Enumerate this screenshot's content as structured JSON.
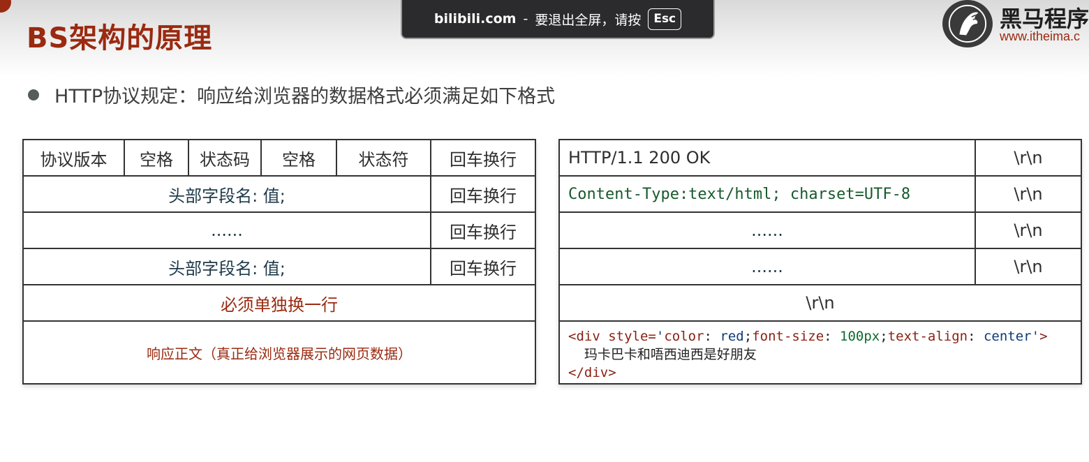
{
  "slide": {
    "title": "BS架构的原理",
    "bullet": "HTTP协议规定：响应给浏览器的数据格式必须满足如下格式"
  },
  "fullscreen_banner": {
    "site": "bilibili.com",
    "separator": "-",
    "message": "要退出全屏，请按",
    "key": "Esc"
  },
  "logo": {
    "icon": "horse-logo-icon",
    "name": "黑马程序",
    "url": "www.itheima.c"
  },
  "left_table": {
    "status_line": [
      "协议版本",
      "空格",
      "状态码",
      "空格",
      "状态符",
      "回车换行"
    ],
    "header_rows": [
      {
        "field": "头部字段名: 值;",
        "end": "回车换行"
      },
      {
        "field": "......",
        "end": "回车换行"
      },
      {
        "field": "头部字段名: 值;",
        "end": "回车换行"
      }
    ],
    "blank_line": "必须单独换一行",
    "body": "响应正文（真正给浏览器展示的网页数据）"
  },
  "right_table": {
    "rows": [
      {
        "left": "HTTP/1.1 200 OK",
        "right": "\\r\\n"
      },
      {
        "left": "Content-Type:text/html; charset=UTF-8",
        "right": "\\r\\n"
      },
      {
        "left": "......",
        "right": "\\r\\n"
      },
      {
        "left": "......",
        "right": "\\r\\n"
      }
    ],
    "blank_line": "\\r\\n",
    "body_code": {
      "open_tag": "<div",
      "attr_style": "style=",
      "q1": "'",
      "p_color": "color",
      "colon1": ": ",
      "v_red": "red",
      "semi1": ";",
      "p_fontsize": "font-size",
      "colon2": ": ",
      "v_size": "100px",
      "semi2": ";",
      "p_textalign": "text-align",
      "colon3": ": ",
      "v_center": "center",
      "q2": "'",
      "gt": ">",
      "content": "玛卡巴卡和唔西迪西是好朋友",
      "close_tag": "</div>"
    }
  },
  "colors": {
    "title_red": "#9a2a10",
    "header_dark": "#1e3a4a",
    "code_green": "#175a2c"
  }
}
